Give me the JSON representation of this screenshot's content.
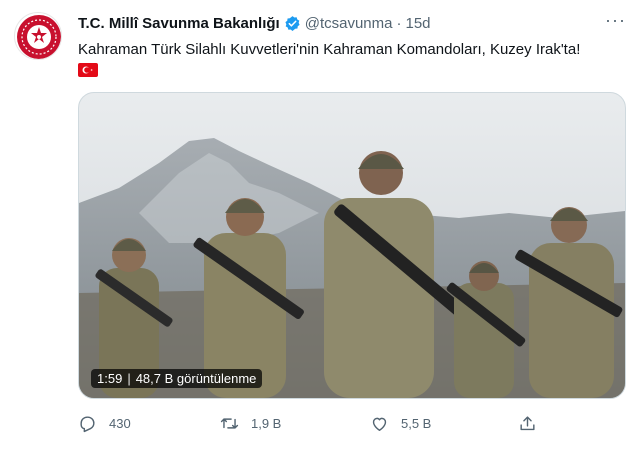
{
  "account": {
    "display_name": "T.C. Millî Savunma Bakanlığı",
    "handle": "@tcsavunma",
    "separator": "·",
    "time": "15d",
    "more_label": "···"
  },
  "tweet": {
    "text": "Kahraman Türk Silahlı Kuvvetleri'nin Kahraman Komandoları, Kuzey Irak'ta!"
  },
  "media": {
    "type": "video",
    "duration": "1:59",
    "badge_separator": "|",
    "views": "48,7 B görüntülenme"
  },
  "actions": {
    "reply_count": "430",
    "retweet_count": "1,9 B",
    "like_count": "5,5 B"
  },
  "colors": {
    "verified": "#1d9bf0",
    "muted_text": "#536471",
    "flag_red": "#e30a17",
    "seal_red": "#c8102e"
  },
  "icons": {
    "verified": "verified-badge-icon",
    "flag": "turkey-flag-icon",
    "reply": "reply-icon",
    "retweet": "retweet-icon",
    "like": "heart-icon",
    "share": "share-icon",
    "more": "more-dots-icon"
  }
}
